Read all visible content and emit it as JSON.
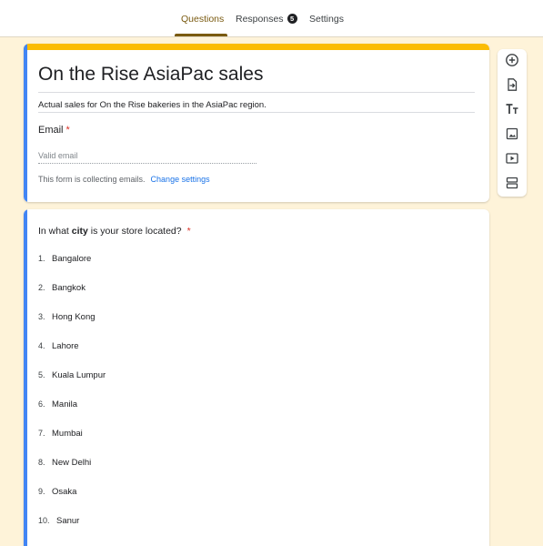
{
  "tabs": [
    {
      "label": "Questions",
      "active": true
    },
    {
      "label": "Responses",
      "badge": "5"
    },
    {
      "label": "Settings"
    }
  ],
  "form": {
    "title": "On the Rise AsiaPac sales",
    "description": "Actual sales for On the Rise bakeries in the AsiaPac region.",
    "email_label": "Email",
    "required_mark": "*",
    "email_placeholder": "Valid email",
    "collecting_note": "This form is collecting emails.",
    "change_settings": "Change settings"
  },
  "question": {
    "text_before": "In what ",
    "text_bold": "city",
    "text_after": " is your store located?",
    "required_mark": "*",
    "options": [
      {
        "num": "1.",
        "label": "Bangalore"
      },
      {
        "num": "2.",
        "label": "Bangkok"
      },
      {
        "num": "3.",
        "label": "Hong Kong"
      },
      {
        "num": "4.",
        "label": "Lahore"
      },
      {
        "num": "5.",
        "label": "Kuala Lumpur"
      },
      {
        "num": "6.",
        "label": "Manila"
      },
      {
        "num": "7.",
        "label": "Mumbai"
      },
      {
        "num": "8.",
        "label": "New Delhi"
      },
      {
        "num": "9.",
        "label": "Osaka"
      },
      {
        "num": "10.",
        "label": "Sanur"
      }
    ]
  },
  "toolbar_icons": [
    "add-question-icon",
    "import-questions-icon",
    "add-title-icon",
    "add-image-icon",
    "add-video-icon",
    "add-section-icon"
  ],
  "colors": {
    "background": "#fef3d9",
    "title_accent": "#fbbc04",
    "focus_accent": "#4285f4",
    "active_tab": "#7a5a10",
    "link": "#1a73e8",
    "required": "#d93025"
  }
}
